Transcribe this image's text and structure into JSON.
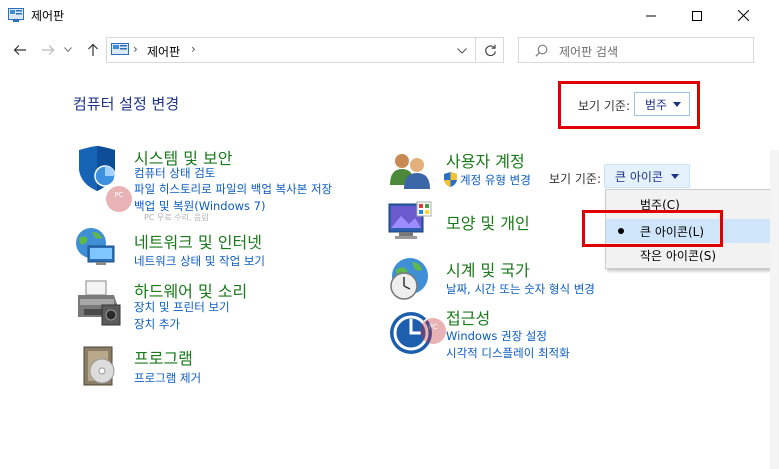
{
  "window": {
    "title": "제어판"
  },
  "address": {
    "path_root": "제어판",
    "search_placeholder": "제어판 검색"
  },
  "main": {
    "heading": "컴퓨터 설정 변경",
    "view_by_label": "보기 기준:",
    "view_by_value": "범주",
    "view_by_label_2": "보기 기준:",
    "view_by_value_2": "큰 아이콘"
  },
  "view_menu": {
    "items": [
      "범주(C)",
      "큰 아이콘(L)",
      "작은 아이콘(S)"
    ],
    "selected_index": 1
  },
  "categories": {
    "system": {
      "title": "시스템 및 보안",
      "links": [
        "컴퓨터 상태 검토",
        "파일 히스토리로 파일의 백업 복사본 저장",
        "백업 및 복원(Windows 7)"
      ]
    },
    "network": {
      "title": "네트워크 및 인터넷",
      "links": [
        "네트워크 상태 및 작업 보기"
      ]
    },
    "hardware": {
      "title": "하드웨어 및 소리",
      "links": [
        "장치 및 프린터 보기",
        "장치 추가"
      ]
    },
    "programs": {
      "title": "프로그램",
      "links": [
        "프로그램 제거"
      ]
    },
    "user": {
      "title": "사용자 계정",
      "links": [
        "계정 유형 변경"
      ]
    },
    "appearance": {
      "title": "모양 및 개인"
    },
    "clock": {
      "title": "시계 및 국가",
      "links": [
        "날짜, 시간 또는 숫자 형식 변경"
      ]
    },
    "access": {
      "title": "접근성",
      "links": [
        "Windows 권장 설정",
        "시각적 디스플레이 최적화"
      ]
    }
  },
  "watermark": {
    "text": "PC 무료 수리, 음림"
  },
  "colors": {
    "highlight_red": "#e10000",
    "link_blue": "#0b5cc0",
    "category_green": "#1a7a1a"
  }
}
